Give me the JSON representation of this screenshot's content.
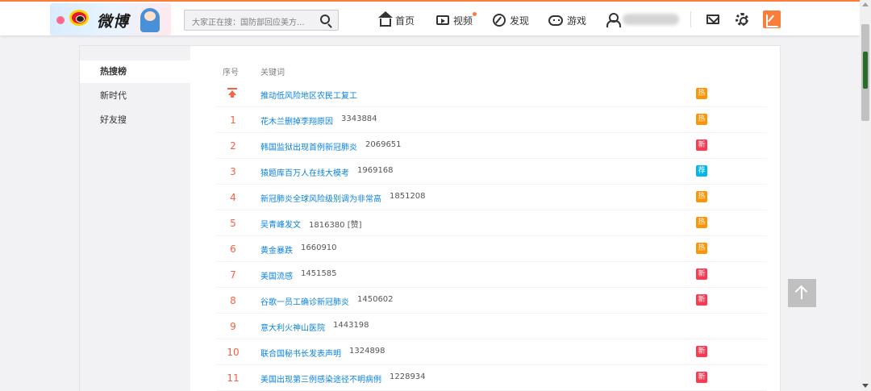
{
  "header": {
    "logo_text": "微博",
    "search": {
      "placeholder": "大家正在搜：国防部回应美方..."
    },
    "nav": [
      {
        "icon": "home-icon",
        "label": "首页"
      },
      {
        "icon": "video-icon",
        "label": "视频"
      },
      {
        "icon": "discover-icon",
        "label": "发现"
      },
      {
        "icon": "game-icon",
        "label": "游戏"
      }
    ]
  },
  "sidebar": {
    "items": [
      {
        "label": "热搜榜",
        "active": true
      },
      {
        "label": "新时代",
        "active": false
      },
      {
        "label": "好友搜",
        "active": false
      }
    ]
  },
  "table": {
    "headers": {
      "rank": "序号",
      "keyword": "关键词"
    },
    "rows": [
      {
        "rank": "",
        "pinned": true,
        "keyword": "推动低风险地区农民工复工",
        "count": "",
        "badge": "热"
      },
      {
        "rank": "1",
        "keyword": "花木兰删掉李翔原因",
        "count": "3343884",
        "badge": "热"
      },
      {
        "rank": "2",
        "keyword": "韩国监狱出现首例新冠肺炎",
        "count": "2069651",
        "badge": "新"
      },
      {
        "rank": "3",
        "keyword": "猿题库百万人在线大模考",
        "count": "1969168",
        "badge": "荐"
      },
      {
        "rank": "4",
        "keyword": "新冠肺炎全球风险级别调为非常高",
        "count": "1851208",
        "badge": "热"
      },
      {
        "rank": "5",
        "keyword": "吴青峰发文",
        "count": "1816380 [赞]",
        "badge": "热"
      },
      {
        "rank": "6",
        "keyword": "黄金暴跌",
        "count": "1660910",
        "badge": "热"
      },
      {
        "rank": "7",
        "keyword": "美国流感",
        "count": "1451585",
        "badge": "新"
      },
      {
        "rank": "8",
        "keyword": "谷歌一员工确诊新冠肺炎",
        "count": "1450602",
        "badge": "新"
      },
      {
        "rank": "9",
        "keyword": "意大利火神山医院",
        "count": "1443198",
        "badge": ""
      },
      {
        "rank": "10",
        "keyword": "联合国秘书长发表声明",
        "count": "1324898",
        "badge": "新"
      },
      {
        "rank": "11",
        "keyword": "美国出现第三例感染途径不明病例",
        "count": "1228934",
        "badge": "新"
      }
    ]
  },
  "badge_colors": {
    "热": "#ff9406",
    "新": "#ff3852",
    "荐": "#00b7ee"
  },
  "colors": {
    "accent": "#fa7d3c",
    "link": "#0b82dc",
    "rank": "#f76141"
  }
}
